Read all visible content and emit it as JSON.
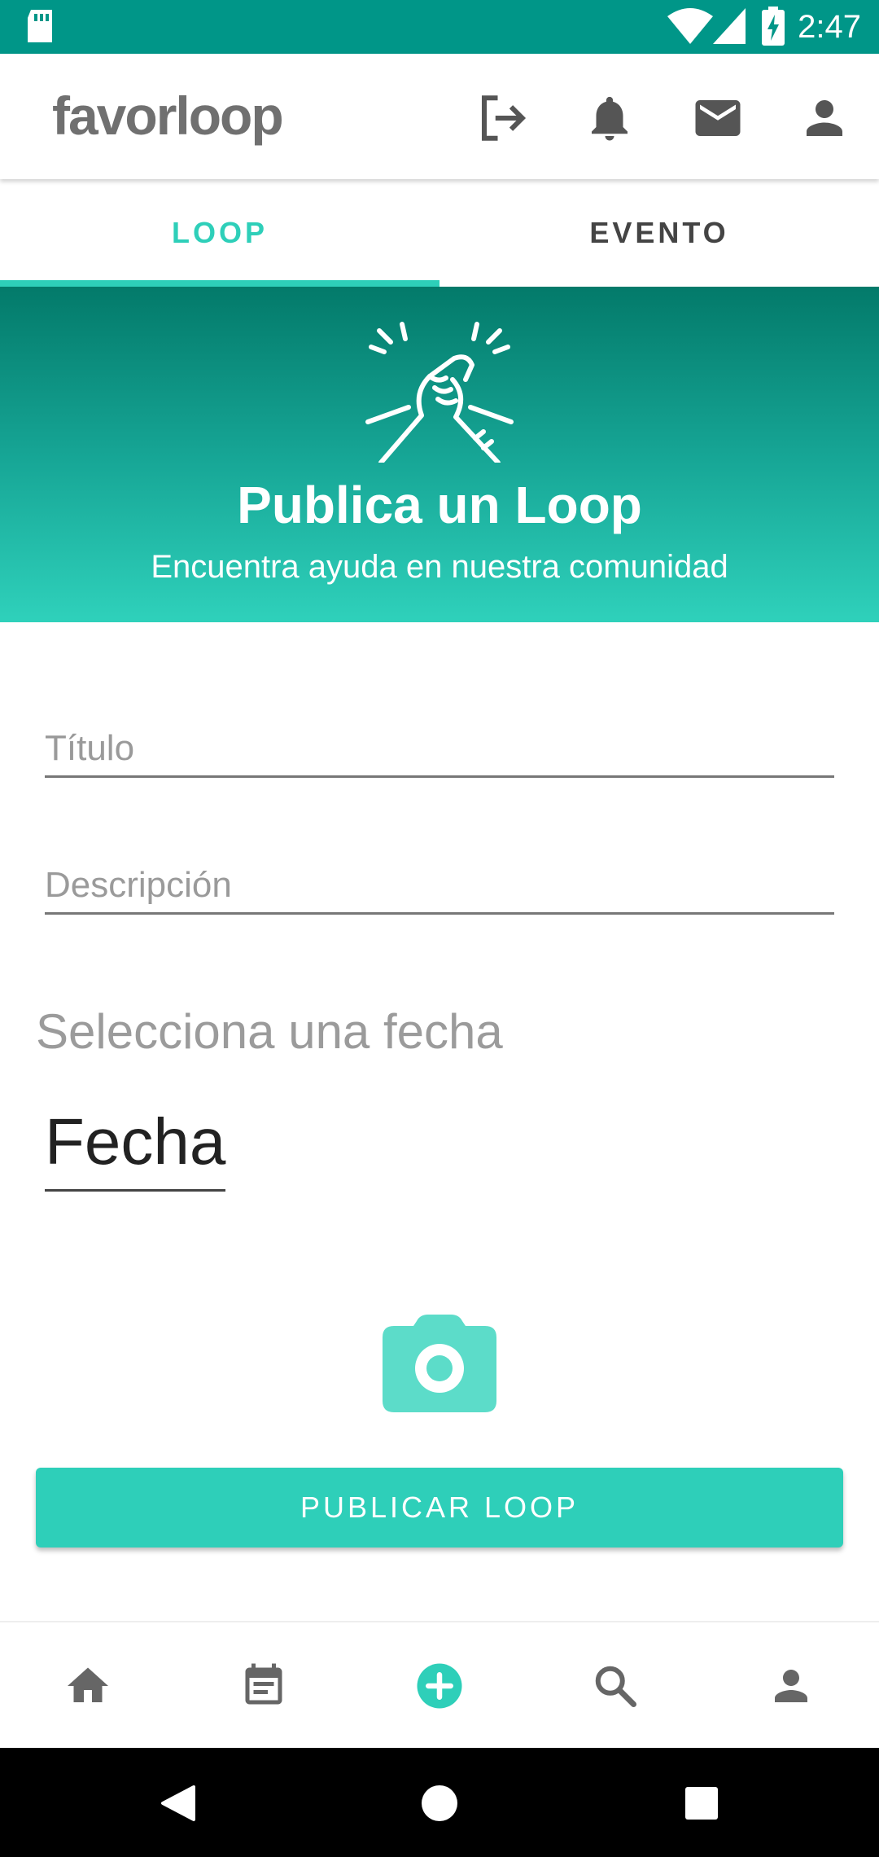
{
  "status": {
    "time": "2:47"
  },
  "app": {
    "logo": "favorloop"
  },
  "tabs": [
    {
      "label": "LOOP"
    },
    {
      "label": "EVENTO"
    }
  ],
  "hero": {
    "title": "Publica un Loop",
    "subtitle": "Encuentra ayuda en nuestra comunidad"
  },
  "form": {
    "title_placeholder": "Título",
    "description_placeholder": "Descripción",
    "date_heading": "Selecciona una fecha",
    "date_value": "Fecha",
    "publish_label": "PUBLICAR LOOP"
  },
  "bottom_nav": [
    "home-icon",
    "calendar-icon",
    "add-circle-icon",
    "search-icon",
    "person-icon"
  ],
  "colors": {
    "accent": "#2ecfb9",
    "status": "#009688",
    "hero_top": "#037a6a"
  }
}
